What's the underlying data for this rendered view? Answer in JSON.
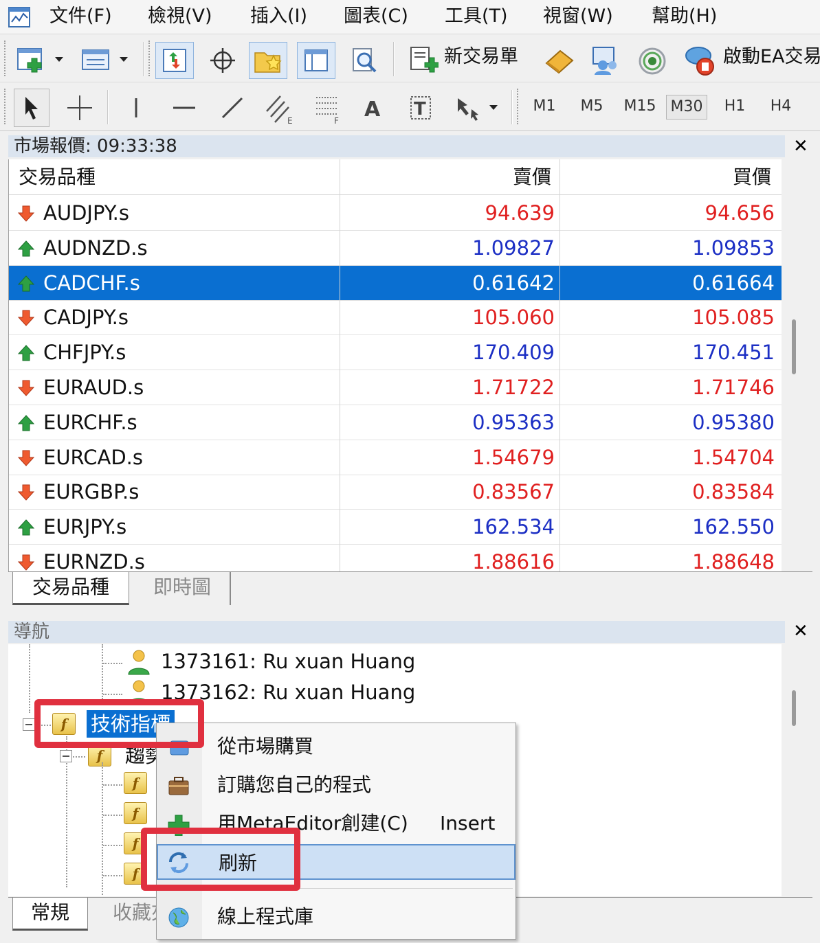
{
  "menu": [
    "文件(F)",
    "檢視(V)",
    "插入(I)",
    "圖表(C)",
    "工具(T)",
    "視窗(W)",
    "幫助(H)"
  ],
  "toolbar": {
    "new_order_label": "新交易單",
    "autotrading_label": "啟動EA交易"
  },
  "timeframes": [
    "M1",
    "M5",
    "M15",
    "M30",
    "H1",
    "H4"
  ],
  "active_timeframe": "M30",
  "market_watch": {
    "title": "市場報價: 09:33:38",
    "columns": [
      "交易品種",
      "賣價",
      "買價"
    ],
    "rows": [
      {
        "symbol": "AUDJPY.s",
        "bid": "94.639",
        "ask": "94.656",
        "dir": "down"
      },
      {
        "symbol": "AUDNZD.s",
        "bid": "1.09827",
        "ask": "1.09853",
        "dir": "up"
      },
      {
        "symbol": "CADCHF.s",
        "bid": "0.61642",
        "ask": "0.61664",
        "dir": "up",
        "selected": true
      },
      {
        "symbol": "CADJPY.s",
        "bid": "105.060",
        "ask": "105.085",
        "dir": "down"
      },
      {
        "symbol": "CHFJPY.s",
        "bid": "170.409",
        "ask": "170.451",
        "dir": "up"
      },
      {
        "symbol": "EURAUD.s",
        "bid": "1.71722",
        "ask": "1.71746",
        "dir": "down"
      },
      {
        "symbol": "EURCHF.s",
        "bid": "0.95363",
        "ask": "0.95380",
        "dir": "up"
      },
      {
        "symbol": "EURCAD.s",
        "bid": "1.54679",
        "ask": "1.54704",
        "dir": "down"
      },
      {
        "symbol": "EURGBP.s",
        "bid": "0.83567",
        "ask": "0.83584",
        "dir": "down"
      },
      {
        "symbol": "EURJPY.s",
        "bid": "162.534",
        "ask": "162.550",
        "dir": "up"
      },
      {
        "symbol": "EURNZD.s",
        "bid": "1.88616",
        "ask": "1.88648",
        "dir": "down"
      }
    ],
    "tabs": [
      "交易品種",
      "即時圖"
    ]
  },
  "navigator": {
    "title": "導航",
    "accounts": [
      "1373161: Ru xuan Huang",
      "1373162: Ru xuan Huang"
    ],
    "indicators_label": "技術指標",
    "trend_label": "趨勢",
    "tabs": [
      "常規",
      "收藏夾"
    ]
  },
  "context_menu": {
    "items": [
      {
        "label": "從市場購買",
        "shortcut": ""
      },
      {
        "label": "訂購您自己的程式",
        "shortcut": ""
      },
      {
        "label": "用MetaEditor創建(C)",
        "shortcut": "Insert"
      },
      {
        "label": "刷新",
        "shortcut": ""
      },
      {
        "label": "線上程式庫",
        "shortcut": ""
      }
    ]
  },
  "colors": {
    "down_price": "#e02020",
    "up_price": "#1c2fc4",
    "selection": "#0a6fd1",
    "highlight_box": "#e0303f"
  }
}
